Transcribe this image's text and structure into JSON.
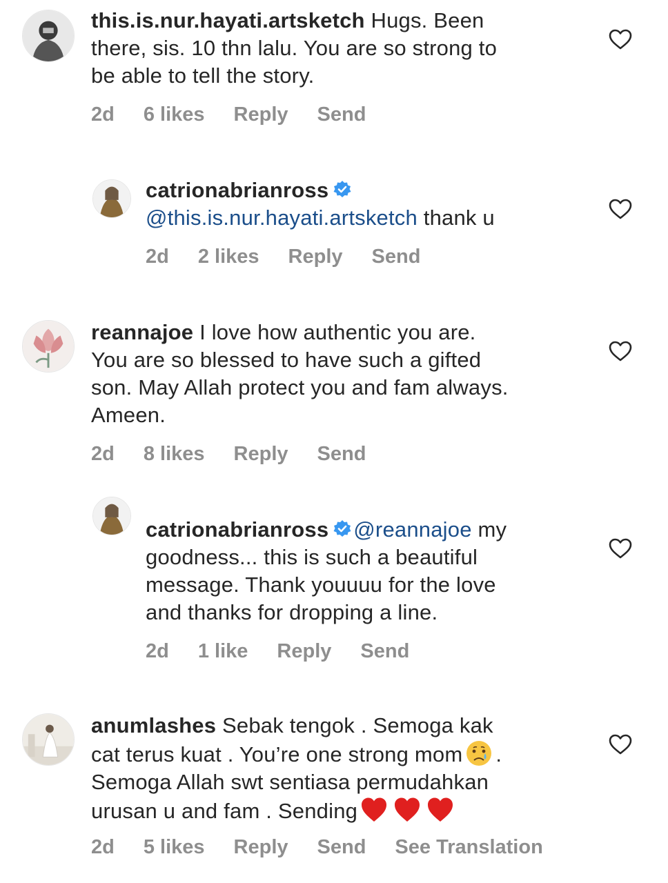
{
  "comments": [
    {
      "username": "this.is.nur.hayati.artsketch",
      "lines": [
        " Hugs. Been",
        "there, sis. 10 thn lalu. You are so strong to",
        "be able to tell the story."
      ],
      "meta": {
        "time": "2d",
        "likes": "6 likes",
        "reply": "Reply",
        "send": "Send"
      }
    },
    {
      "username": "catrionabrianross",
      "mention": "@this.is.nur.hayati.artsketch",
      "text": " thank u",
      "meta": {
        "time": "2d",
        "likes": "2 likes",
        "reply": "Reply",
        "send": "Send"
      }
    },
    {
      "username": "reannajoe",
      "lines": [
        " I love how authentic you are.",
        "You are so blessed to have such a gifted",
        "son. May Allah protect you and fam always.",
        "Ameen."
      ],
      "meta": {
        "time": "2d",
        "likes": "8 likes",
        "reply": "Reply",
        "send": "Send"
      }
    },
    {
      "username": "catrionabrianross",
      "mention": "@reannajoe",
      "lines": [
        " my",
        "goodness... this is such a beautiful",
        "message. Thank youuuu for the love",
        "and thanks for dropping a line."
      ],
      "meta": {
        "time": "2d",
        "likes": "1 like",
        "reply": "Reply",
        "send": "Send"
      }
    },
    {
      "username": "anumlashes",
      "lines": [
        " Sebak tengok . Semoga kak",
        "cat terus kuat . You’re one strong mom",
        ".",
        "Semoga Allah swt sentiasa permudahkan",
        "urusan u and fam . Sending"
      ],
      "meta": {
        "time": "2d",
        "likes": "5 likes",
        "reply": "Reply",
        "send": "Send",
        "translate": "See Translation"
      }
    }
  ],
  "icons": {
    "like": "heart-outline-icon",
    "verified": "verified-badge-icon",
    "crying": "crying-face-emoji",
    "heart": "red-heart-emoji"
  },
  "colors": {
    "text": "#262626",
    "meta": "#8e8e8e",
    "mention": "#1b4e8a",
    "verified": "#3897f0",
    "heart_emoji": "#e0201f"
  }
}
